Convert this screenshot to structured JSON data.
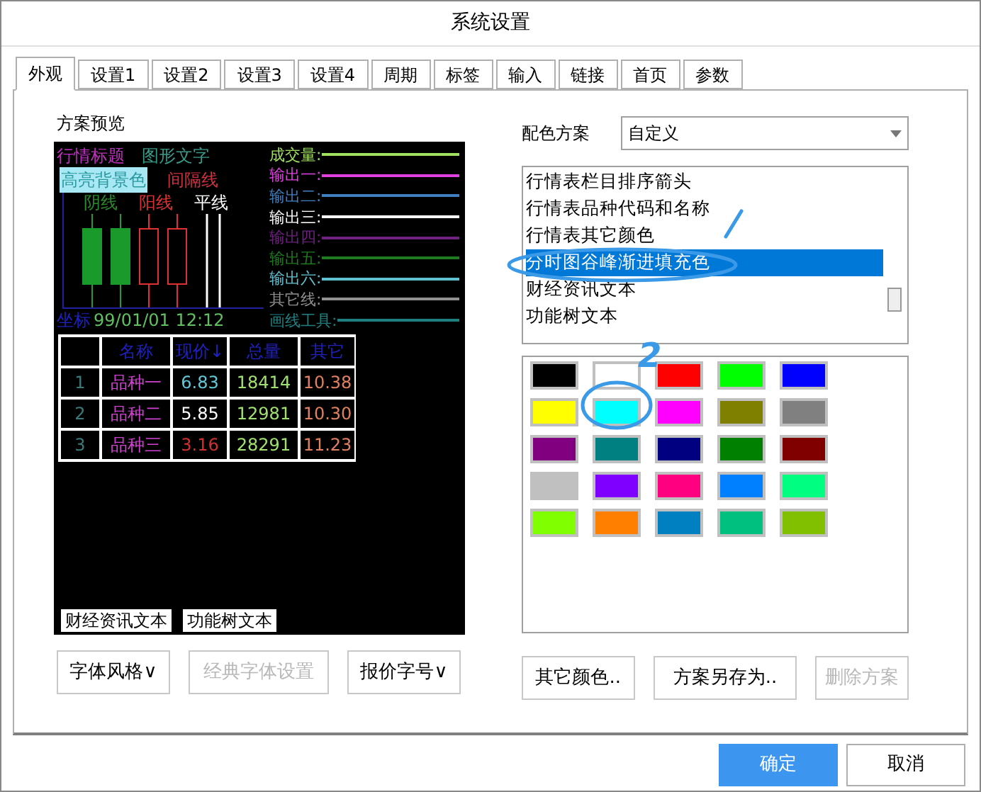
{
  "window": {
    "title": "系统设置"
  },
  "tabs": [
    {
      "label": "外观",
      "selected": true
    },
    {
      "label": "设置1",
      "selected": false
    },
    {
      "label": "设置2",
      "selected": false
    },
    {
      "label": "设置3",
      "selected": false
    },
    {
      "label": "设置4",
      "selected": false
    },
    {
      "label": "周期",
      "selected": false
    },
    {
      "label": "标签",
      "selected": false
    },
    {
      "label": "输入",
      "selected": false
    },
    {
      "label": "链接",
      "selected": false
    },
    {
      "label": "首页",
      "selected": false
    },
    {
      "label": "参数",
      "selected": false
    }
  ],
  "preview": {
    "label": "方案预览",
    "title_text": {
      "text": "行情标题",
      "color": "#c030c0"
    },
    "graphic_text": {
      "text": "图形文字",
      "color": "#3a9a8a"
    },
    "highlight": {
      "text": "高亮背景色",
      "color": "#a8e8f4"
    },
    "divider_text": {
      "text": "间隔线",
      "color": "#d03040"
    },
    "candle_labels": [
      {
        "text": "阴线",
        "color": "#2a8a2a"
      },
      {
        "text": "阳线",
        "color": "#e03030"
      },
      {
        "text": "平线",
        "color": "#ffffff"
      }
    ],
    "axis_label": {
      "text": "坐标",
      "color": "#2020c0"
    },
    "axis_time": {
      "text": "99/01/01 12:12",
      "color": "#60c060"
    },
    "legend": [
      {
        "text": "成交量:",
        "color": "#a0e060"
      },
      {
        "text": "输出一:",
        "color": "#e040e0"
      },
      {
        "text": "输出二:",
        "color": "#4080c0"
      },
      {
        "text": "输出三:",
        "color": "#ffffff"
      },
      {
        "text": "输出四:",
        "color": "#702080"
      },
      {
        "text": "输出五:",
        "color": "#207a20"
      },
      {
        "text": "输出六:",
        "color": "#60c0d0"
      },
      {
        "text": "其它线:",
        "color": "#909090"
      },
      {
        "text": "画线工具:",
        "color": "#208080"
      }
    ],
    "table": {
      "columns": [
        "",
        "名称",
        "现价↓",
        "总量",
        "其它"
      ],
      "rows": [
        {
          "index": "1",
          "name": "品种一",
          "price": {
            "text": "6.83",
            "color": "#60c8d8"
          },
          "volume": "18414",
          "other": "10.38"
        },
        {
          "index": "2",
          "name": "品种二",
          "price": {
            "text": "5.85",
            "color": "#ffffff"
          },
          "volume": "12981",
          "other": "10.30"
        },
        {
          "index": "3",
          "name": "品种三",
          "price": {
            "text": "3.16",
            "color": "#d03030"
          },
          "volume": "28291",
          "other": "11.23"
        }
      ]
    },
    "sample_buttons": [
      "财经资讯文本",
      "功能树文本"
    ]
  },
  "left_buttons": [
    {
      "label": "字体风格∨",
      "disabled": false
    },
    {
      "label": "经典字体设置",
      "disabled": true
    },
    {
      "label": "报价字号∨",
      "disabled": false
    }
  ],
  "scheme": {
    "label": "配色方案",
    "value": "自定义"
  },
  "items": [
    {
      "label": "行情表栏目排序箭头",
      "selected": false
    },
    {
      "label": "行情表品种代码和名称",
      "selected": false
    },
    {
      "label": "行情表其它颜色",
      "selected": false
    },
    {
      "label": "分时图谷峰渐进填充色",
      "selected": true
    },
    {
      "label": "财经资讯文本",
      "selected": false
    },
    {
      "label": "功能树文本",
      "selected": false
    }
  ],
  "swatches": [
    {
      "color": "#000000"
    },
    {
      "color": "#ffffff"
    },
    {
      "color": "#ff0000"
    },
    {
      "color": "#00ff00"
    },
    {
      "color": "#0000ff"
    },
    {
      "color": "#ffff00"
    },
    {
      "color": "#00ffff"
    },
    {
      "color": "#ff00ff"
    },
    {
      "color": "#808000"
    },
    {
      "color": "#808080"
    },
    {
      "color": "#800080"
    },
    {
      "color": "#008080"
    },
    {
      "color": "#000080"
    },
    {
      "color": "#008000"
    },
    {
      "color": "#800000"
    },
    {
      "color": "#c0c0c0"
    },
    {
      "color": "#8000ff"
    },
    {
      "color": "#ff0080"
    },
    {
      "color": "#0080ff"
    },
    {
      "color": "#00ff80"
    },
    {
      "color": "#80ff00"
    },
    {
      "color": "#ff8000"
    },
    {
      "color": "#0080c0"
    },
    {
      "color": "#00c080"
    },
    {
      "color": "#80c000"
    }
  ],
  "right_buttons": [
    {
      "label": "其它颜色..",
      "disabled": false
    },
    {
      "label": "方案另存为..",
      "disabled": false
    },
    {
      "label": "删除方案",
      "disabled": true
    }
  ],
  "annotation": {
    "mark": "2"
  },
  "footer_buttons": [
    {
      "label": "确定",
      "kind": "primary"
    },
    {
      "label": "取消",
      "kind": "normal"
    }
  ]
}
